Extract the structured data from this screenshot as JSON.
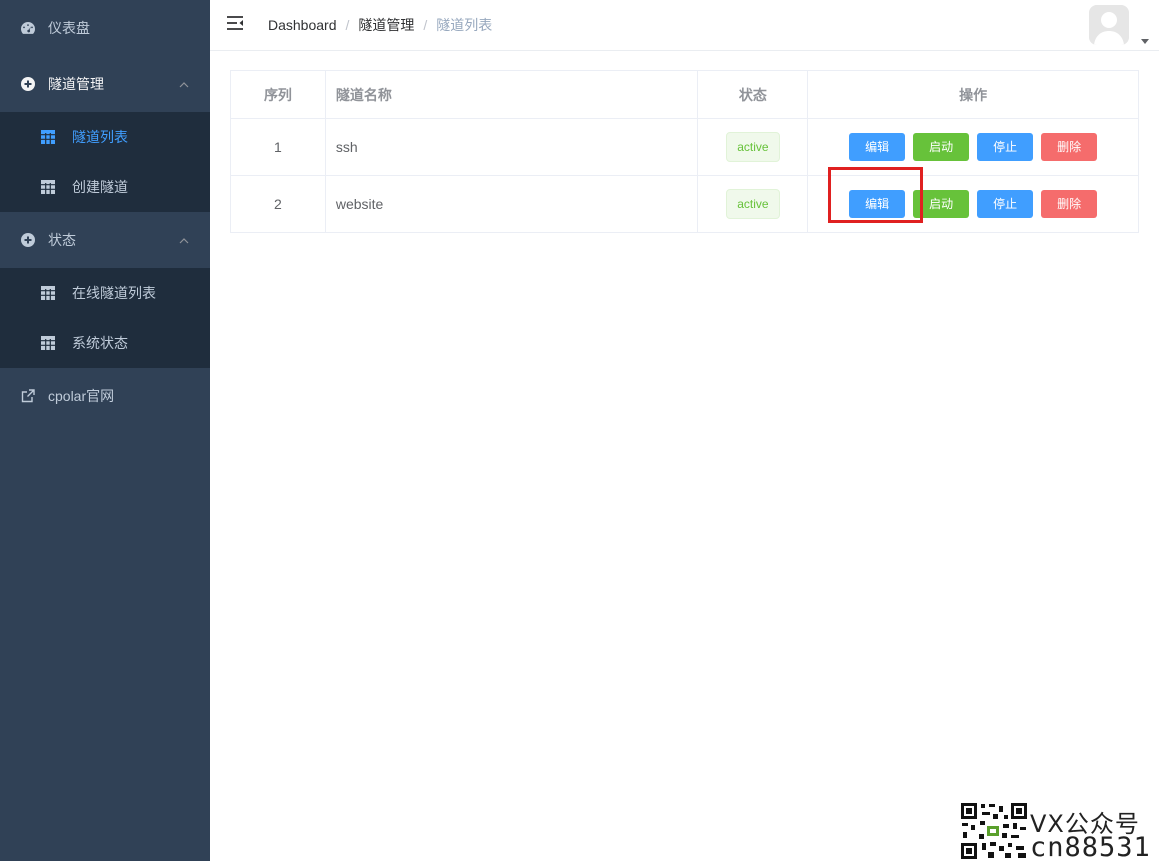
{
  "sidebar": {
    "items": [
      {
        "label": "仪表盘",
        "icon": "dashboard-icon"
      },
      {
        "label": "隧道管理",
        "icon": "plus-circle-icon",
        "expanded": true,
        "children": [
          {
            "label": "隧道列表",
            "icon": "grid-icon",
            "active": true
          },
          {
            "label": "创建隧道",
            "icon": "grid-icon"
          }
        ]
      },
      {
        "label": "状态",
        "icon": "plus-circle-icon",
        "expanded": true,
        "children": [
          {
            "label": "在线隧道列表",
            "icon": "grid-icon"
          },
          {
            "label": "系统状态",
            "icon": "grid-icon"
          }
        ]
      },
      {
        "label": "cpolar官网",
        "icon": "external-link-icon"
      }
    ]
  },
  "header": {
    "breadcrumb": [
      "Dashboard",
      "隧道管理",
      "隧道列表"
    ]
  },
  "table": {
    "columns": [
      "序列",
      "隧道名称",
      "状态",
      "操作"
    ],
    "rows": [
      {
        "index": "1",
        "name": "ssh",
        "status": "active"
      },
      {
        "index": "2",
        "name": "website",
        "status": "active"
      }
    ],
    "actions": {
      "edit": "编辑",
      "start": "启动",
      "stop": "停止",
      "delete": "删除"
    }
  },
  "watermark": {
    "line1": "VX公众号",
    "line2": "cn88531"
  },
  "colors": {
    "sidebar_bg": "#304156",
    "submenu_bg": "#1f2d3d",
    "accent": "#409eff",
    "success": "#67c23a",
    "danger": "#f56c6c",
    "highlight": "#e02020"
  }
}
